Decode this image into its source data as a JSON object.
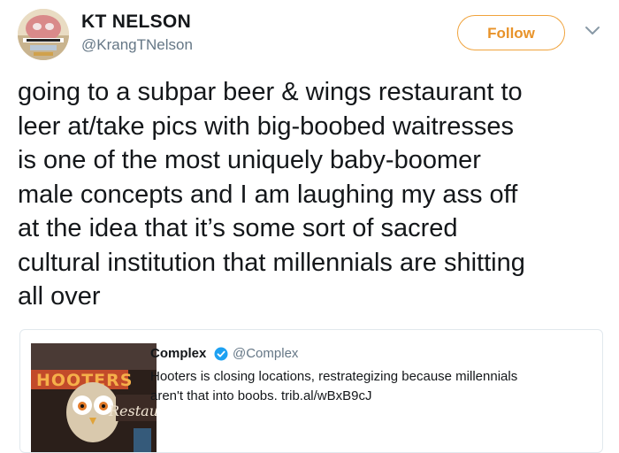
{
  "tweet": {
    "author": {
      "display_name": "KT NELSON",
      "username": "@KrangTNelson",
      "avatar_icon": "avatar-photo"
    },
    "follow_label": "Follow",
    "menu_icon": "chevron-down-icon",
    "text": "going to a subpar beer & wings restaurant to\nleer at/take pics with big-boobed waitresses\nis one of the most uniquely baby-boomer\nmale concepts and I am laughing my ass off\nat the idea that it’s some sort of sacred\ncultural institution that millennials are shitting\nall over",
    "quoted": {
      "author": "Complex",
      "verified_icon": "verified-badge-icon",
      "handle": "@Complex",
      "text": "Hooters is closing locations, restrategizing because millennials\naren't that into boobs. trib.al/wBxB9cJ",
      "thumbnail_sign": "HOOTERS",
      "thumbnail_sub": "Restau"
    }
  },
  "colors": {
    "follow_accent": "#e8932a",
    "secondary_text": "#657786",
    "verified": "#1da1f2",
    "card_border": "#e1e8ed"
  }
}
